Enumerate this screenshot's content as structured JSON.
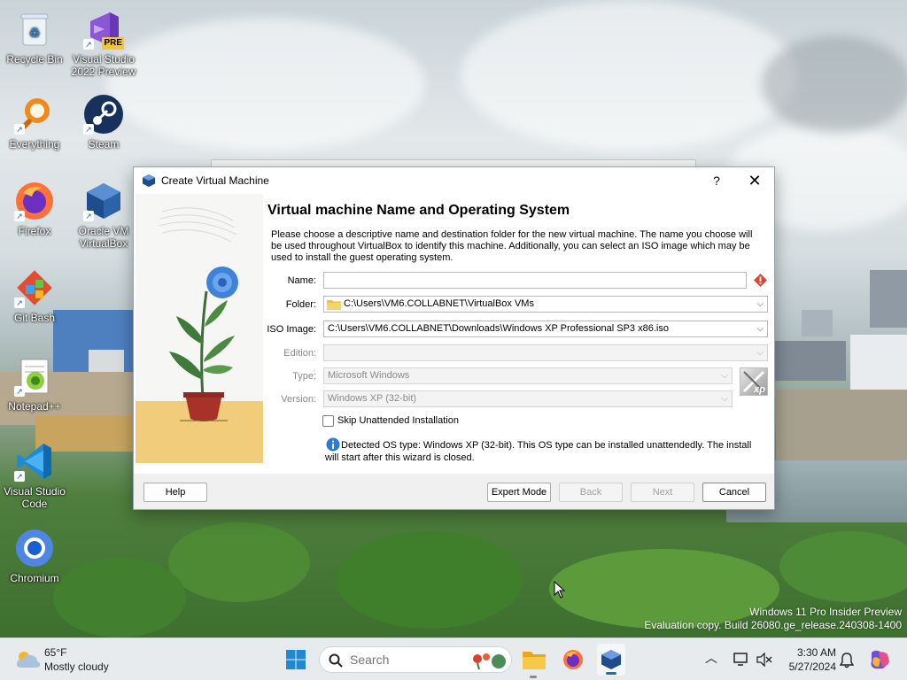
{
  "desktop": {
    "icons": [
      {
        "name": "recycle-bin",
        "label_line1": "Recycle Bin",
        "label_line2": ""
      },
      {
        "name": "visual-studio-2022-preview",
        "label_line1": "Visual Studio",
        "label_line2": "2022 Preview",
        "badge": "PRE"
      },
      {
        "name": "everything",
        "label_line1": "Everything",
        "label_line2": ""
      },
      {
        "name": "steam",
        "label_line1": "Steam",
        "label_line2": ""
      },
      {
        "name": "firefox",
        "label_line1": "Firefox",
        "label_line2": ""
      },
      {
        "name": "oracle-vm-virtualbox",
        "label_line1": "Oracle VM",
        "label_line2": "VirtualBox"
      },
      {
        "name": "git-bash",
        "label_line1": "Git Bash",
        "label_line2": ""
      },
      {
        "name": "notepad-plus-plus",
        "label_line1": "Notepad++",
        "label_line2": ""
      },
      {
        "name": "visual-studio-code",
        "label_line1": "Visual Studio",
        "label_line2": "Code"
      },
      {
        "name": "chromium",
        "label_line1": "Chromium",
        "label_line2": ""
      }
    ],
    "watermark_line1": "Windows 11 Pro Insider Preview",
    "watermark_line2": "Evaluation copy. Build 26080.ge_release.240308-1400"
  },
  "dialog": {
    "title": "Create Virtual Machine",
    "help_glyph": "?",
    "close_glyph": "✕",
    "heading": "Virtual machine Name and Operating System",
    "description": "Please choose a descriptive name and destination folder for the new virtual machine. The name you choose will be used throughout VirtualBox to identify this machine. Additionally, you can select an ISO image which may be used to install the guest operating system.",
    "fields": {
      "name_label": "Name:",
      "name_value": "",
      "folder_label": "Folder:",
      "folder_value": "C:\\Users\\VM6.COLLABNET\\VirtualBox VMs",
      "iso_label": "ISO Image:",
      "iso_value": "C:\\Users\\VM6.COLLABNET\\Downloads\\Windows XP Professional SP3 x86.iso",
      "edition_label": "Edition:",
      "edition_value": "",
      "type_label": "Type:",
      "type_value": "Microsoft Windows",
      "version_label": "Version:",
      "version_value": "Windows XP (32-bit)"
    },
    "os_badge": "xp",
    "skip_unattended_label": "Skip Unattended Installation",
    "skip_unattended_checked": false,
    "info_text": "Detected OS type: Windows XP (32-bit). This OS type can be installed unattendedly. The install will start after this wizard is closed.",
    "buttons": {
      "help": "Help",
      "expert": "Expert Mode",
      "back": "Back",
      "next": "Next",
      "cancel": "Cancel"
    },
    "colors": {
      "error": "#e0462f",
      "info": "#2b7bd4",
      "folder": "#f2c230"
    }
  },
  "taskbar": {
    "weather_temp": "65°F",
    "weather_desc": "Mostly cloudy",
    "search_placeholder": "Search",
    "time": "3:30 AM",
    "date": "5/27/2024"
  }
}
